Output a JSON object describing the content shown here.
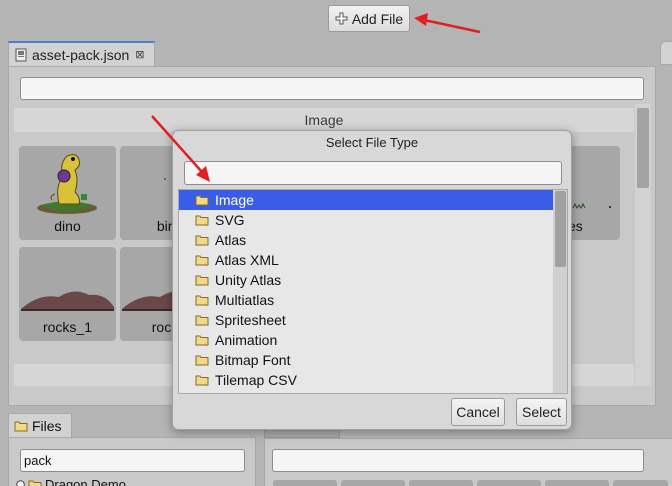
{
  "toolbar": {
    "add_file_label": "Add File"
  },
  "editor": {
    "tab_title": "asset-pack.json",
    "tab_close_glyph": "⊠",
    "section_header": "Image",
    "tiles": [
      {
        "label": "dino"
      },
      {
        "label": "bird"
      },
      {
        "label": "nes"
      },
      {
        "label": "rocks_1"
      },
      {
        "label": "rocks"
      }
    ]
  },
  "dialog": {
    "title": "Select File Type",
    "items": [
      {
        "label": "Image",
        "selected": true
      },
      {
        "label": "SVG"
      },
      {
        "label": "Atlas"
      },
      {
        "label": "Atlas XML"
      },
      {
        "label": "Unity Atlas"
      },
      {
        "label": "Multiatlas"
      },
      {
        "label": "Spritesheet"
      },
      {
        "label": "Animation"
      },
      {
        "label": "Bitmap Font"
      },
      {
        "label": "Tilemap CSV"
      }
    ],
    "cancel_label": "Cancel",
    "select_label": "Select"
  },
  "files_panel": {
    "tab_label": "Files",
    "filter_value": "pack",
    "tree_item": "Dragon Demo"
  },
  "colors": {
    "selection": "#3a5de8",
    "annotation_arrow": "#e02020",
    "tab_accent": "#4a7fd0"
  }
}
